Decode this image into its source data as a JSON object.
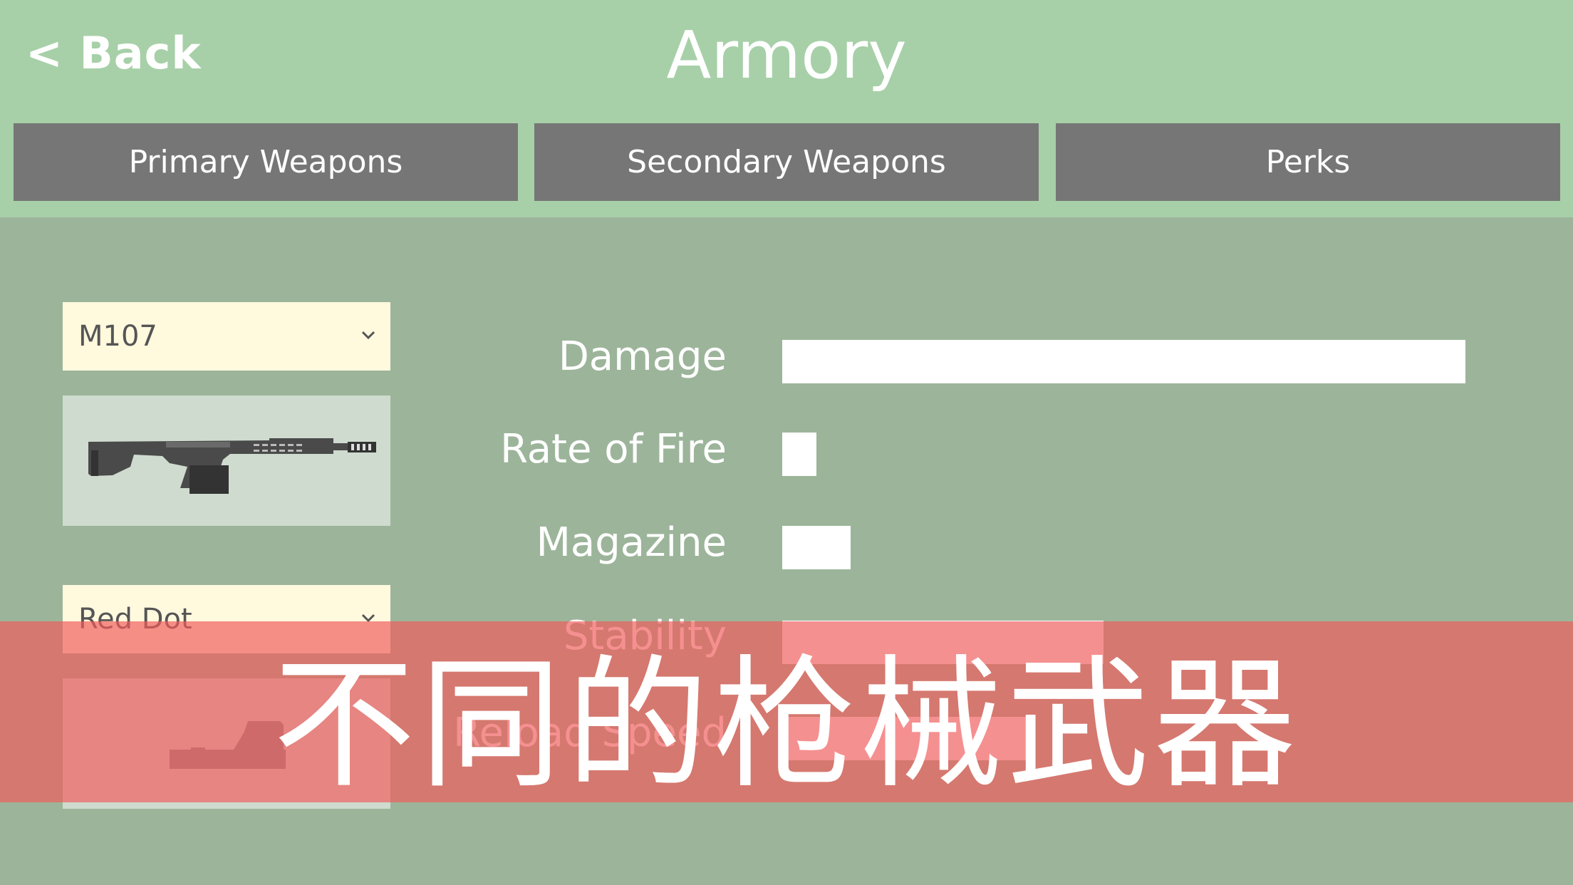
{
  "header": {
    "back_label": "< Back",
    "title": "Armory"
  },
  "tabs": [
    {
      "label": "Primary Weapons"
    },
    {
      "label": "Secondary Weapons"
    },
    {
      "label": "Perks"
    }
  ],
  "loadout": {
    "weapon_select": {
      "value": "M107",
      "icon": "chevron-down-icon"
    },
    "weapon_image": "sniper-rifle-icon",
    "attachment_select": {
      "value": "Red Dot",
      "icon": "chevron-down-icon"
    },
    "attachment_image": "red-dot-sight-icon"
  },
  "stats": [
    {
      "label": "Damage",
      "value": 1.0
    },
    {
      "label": "Rate of Fire",
      "value": 0.05
    },
    {
      "label": "Magazine",
      "value": 0.1
    },
    {
      "label": "Stability",
      "value": 0.47
    },
    {
      "label": "Reload Speed",
      "value": 0.36
    }
  ],
  "overlay_caption": "不同的枪械武器",
  "colors": {
    "header_bg": "#a7d0a8",
    "body_bg": "#9cb59a",
    "tab_bg": "#767676",
    "select_bg": "#fff9de",
    "bar_fill": "#ffffff",
    "caption_band": "#e37a75"
  }
}
